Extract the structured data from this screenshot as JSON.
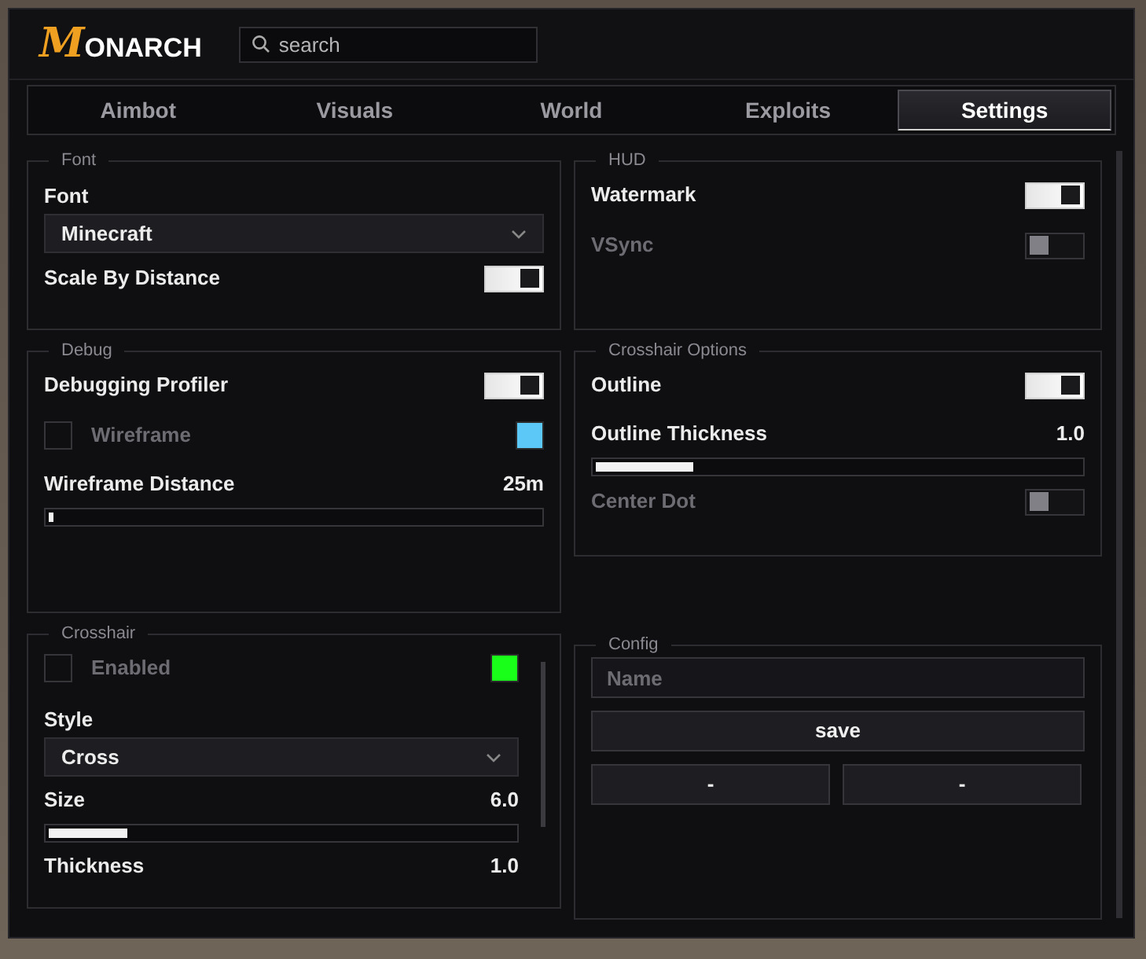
{
  "logo": {
    "initial": "M",
    "rest": "ONARCH"
  },
  "search": {
    "placeholder": "search"
  },
  "tabs": [
    {
      "label": "Aimbot",
      "selected": false
    },
    {
      "label": "Visuals",
      "selected": false
    },
    {
      "label": "World",
      "selected": false
    },
    {
      "label": "Exploits",
      "selected": false
    },
    {
      "label": "Settings",
      "selected": true
    }
  ],
  "columns": [
    {
      "panels": [
        {
          "title": "Font",
          "rows": [
            {
              "kind": "label",
              "label": "Font"
            },
            {
              "kind": "dropdown",
              "value": "Minecraft"
            },
            {
              "kind": "toggle",
              "label": "Scale By Distance",
              "on": true,
              "disabled": false
            }
          ]
        },
        {
          "title": "Debug",
          "rows": [
            {
              "kind": "toggle",
              "label": "Debugging Profiler",
              "on": true,
              "disabled": false
            },
            {
              "kind": "checkbox",
              "label": "Wireframe",
              "checked": false,
              "color": "#5bc8f7"
            },
            {
              "kind": "slider",
              "label": "Wireframe Distance",
              "reading": "25m",
              "level": 0.01
            }
          ]
        },
        {
          "title": "Crosshair",
          "scroll": true,
          "rows": [
            {
              "kind": "checkbox",
              "label": "Enabled",
              "checked": false,
              "color": "#1aff1a"
            },
            {
              "kind": "label",
              "label": "Style"
            },
            {
              "kind": "dropdown",
              "value": "Cross"
            },
            {
              "kind": "slider",
              "label": "Size",
              "reading": "6.0",
              "level": 0.17
            },
            {
              "kind": "reading",
              "label": "Thickness",
              "reading": "1.0"
            }
          ]
        }
      ]
    },
    {
      "panels": [
        {
          "title": "HUD",
          "rows": [
            {
              "kind": "toggle",
              "label": "Watermark",
              "on": true,
              "disabled": false
            },
            {
              "kind": "toggle",
              "label": "VSync",
              "on": false,
              "disabled": true
            }
          ]
        },
        {
          "title": "Crosshair Options",
          "rows": [
            {
              "kind": "toggle",
              "label": "Outline",
              "on": true,
              "disabled": false
            },
            {
              "kind": "slider",
              "label": "Outline Thickness",
              "reading": "1.0",
              "level": 0.2
            },
            {
              "kind": "toggle",
              "label": "Center Dot",
              "on": false,
              "disabled": true
            }
          ]
        },
        {
          "title": "Config",
          "rows": [
            {
              "kind": "input",
              "placeholder": "Name"
            },
            {
              "kind": "button",
              "label": "save"
            },
            {
              "kind": "buttons",
              "labels": [
                "-",
                "-"
              ]
            }
          ]
        }
      ]
    }
  ]
}
